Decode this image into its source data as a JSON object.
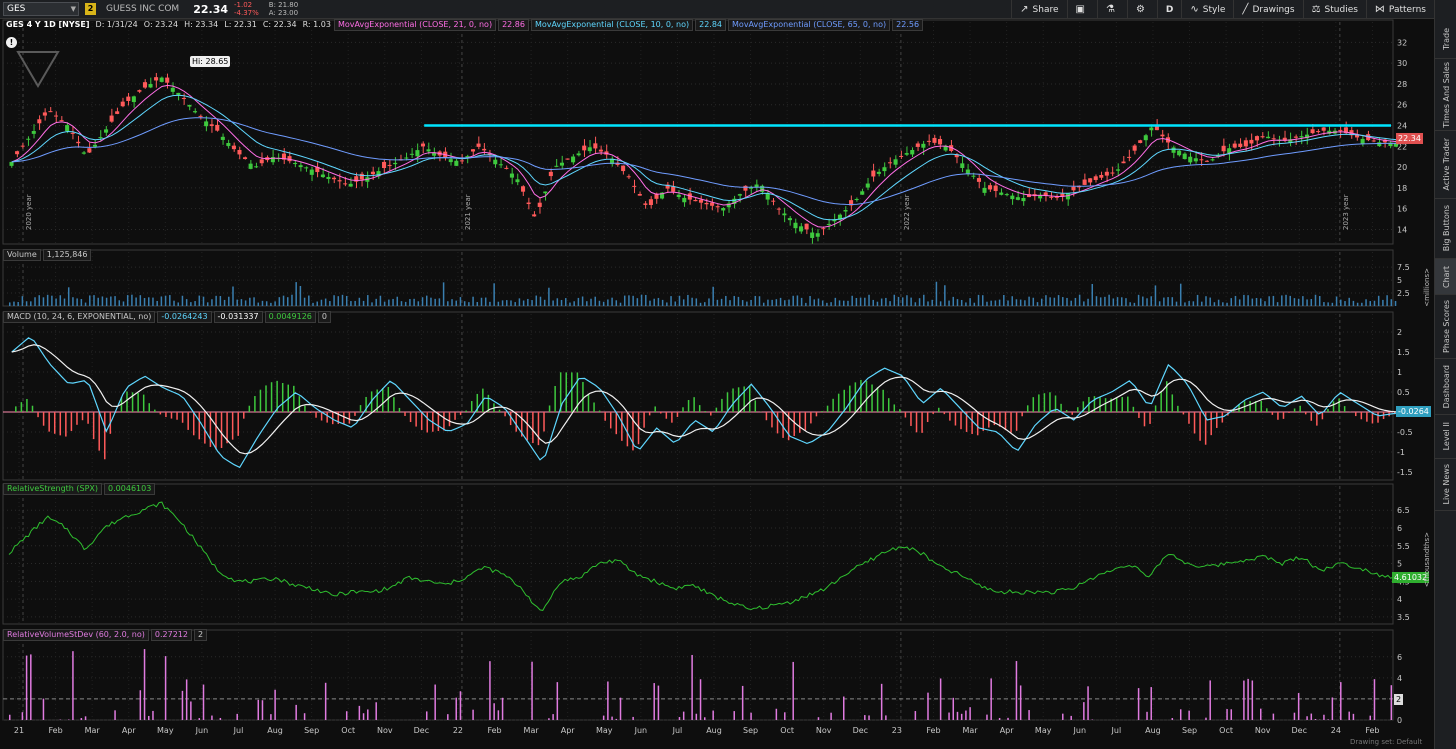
{
  "toolbar": {
    "symbol": "GES",
    "badge": "2",
    "company": "GUESS INC COM",
    "price": "22.34",
    "change": "-1.02",
    "change_pct": "-4.37%",
    "bid": "B: 21.80",
    "ask": "A: 23.00",
    "buttons": {
      "share": "Share",
      "style": "Style",
      "drawings": "Drawings",
      "studies": "Studies",
      "patterns": "Patterns",
      "period": "D"
    }
  },
  "sidebar": {
    "tabs": [
      "Trade",
      "Times And Sales",
      "Active Trader",
      "Big Buttons",
      "Chart",
      "Phase Scores",
      "Dashboard",
      "Level II",
      "Live News"
    ]
  },
  "price_header": {
    "title": "GES 4 Y 1D [NYSE]",
    "d": "D: 1/31/24",
    "o": "O: 23.24",
    "h": "H: 23.34",
    "l": "L: 22.31",
    "c": "C: 22.34",
    "r": "R: 1.03",
    "ema21": "MovAvgExponential (CLOSE, 21, 0, no)",
    "ema21_val": "22.86",
    "ema10": "MovAvgExponential (CLOSE, 10, 0, no)",
    "ema10_val": "22.84",
    "ema65": "MovAvgExponential (CLOSE, 65, 0, no)",
    "ema65_val": "22.56"
  },
  "volume_header": {
    "title": "Volume",
    "value": "1,125,846"
  },
  "macd_header": {
    "title": "MACD (10, 24, 6, EXPONENTIAL, no)",
    "v1": "-0.0264243",
    "v2": "-0.031337",
    "v3": "0.0049126",
    "v4": "0"
  },
  "rs_header": {
    "title": "RelativeStrength (SPX)",
    "value": "0.0046103"
  },
  "rv_header": {
    "title": "RelativeVolumeStDev (60, 2.0, no)",
    "value": "0.27212",
    "v2": "2"
  },
  "tags": {
    "price": "22.34",
    "macd": "-0.0264",
    "rs": "4.61032",
    "rv": "2",
    "hi": "Hi: 28.65"
  },
  "units": {
    "volume": "<millions>",
    "rs": "<thousandths>"
  },
  "year_labels": [
    "2020 year",
    "2021 year",
    "2022 year",
    "2023 year"
  ],
  "footer": {
    "drawing_set": "Drawing set: Default"
  },
  "colors": {
    "up": "#3ec93e",
    "down": "#ff5a5a",
    "ema_fast": "#ff6ee6",
    "ema_mid": "#5fd7ff",
    "ema_slow": "#6f9cff",
    "resistance": "#00e5ff",
    "rs": "#2fbf2f",
    "rv": "#e07be0"
  },
  "chart_data": [
    {
      "type": "line",
      "name": "price",
      "x_labels": [
        "21",
        "Feb",
        "Mar",
        "Apr",
        "May",
        "Jun",
        "Jul",
        "Aug",
        "Sep",
        "Oct",
        "Nov",
        "Dec",
        "22",
        "Feb",
        "Mar",
        "Apr",
        "May",
        "Jun",
        "Jul",
        "Aug",
        "Sep",
        "Oct",
        "Nov",
        "Dec",
        "23",
        "Feb",
        "Mar",
        "Apr",
        "May",
        "Jun",
        "Jul",
        "Aug",
        "Sep",
        "Oct",
        "Nov",
        "Dec",
        "24",
        "Feb"
      ],
      "y_ticks": [
        14,
        16,
        18,
        20,
        22,
        24,
        26,
        28,
        30,
        32
      ],
      "ylim": [
        12.6,
        33
      ],
      "close_series": [
        20.5,
        23,
        25.5,
        24,
        21,
        23.5,
        26,
        27.5,
        28.65,
        27,
        25,
        23.5,
        21.5,
        20,
        21,
        20.5,
        19.8,
        19,
        18.3,
        19,
        20,
        20.8,
        22,
        21,
        20.5,
        22,
        20.5,
        19,
        15,
        20,
        21,
        22,
        21,
        19,
        16,
        18,
        17,
        16.5,
        16,
        17.5,
        18.5,
        16,
        14.5,
        13.5,
        15,
        16.5,
        19,
        20.5,
        21.5,
        22.5,
        22,
        20,
        18,
        17.5,
        17,
        17.3,
        17,
        18,
        18.8,
        19.5,
        21.5,
        24,
        22,
        21,
        20.5,
        21.8,
        22,
        23,
        22.5,
        23,
        23.5,
        23.5,
        22.8,
        22.4,
        22.34
      ],
      "resistance": 24,
      "annotation": "Hi: 28.65"
    },
    {
      "type": "bar",
      "name": "volume",
      "y_ticks": [
        2.5,
        5,
        7.5
      ],
      "ylim": [
        0,
        8.5
      ]
    },
    {
      "type": "line",
      "name": "macd",
      "y_ticks": [
        -1.5,
        -1,
        -0.5,
        0.5,
        1,
        1.5,
        2
      ],
      "ylim": [
        -1.7,
        2.2
      ],
      "macd_series": [
        1.5,
        1.9,
        1.2,
        0.7,
        0.8,
        -0.5,
        0.6,
        0.9,
        0.6,
        0.4,
        -0.3,
        -1.1,
        -1.4,
        -0.6,
        0.1,
        0.5,
        0.1,
        -0.2,
        -0.4,
        0.3,
        0.8,
        0.3,
        -0.2,
        -0.5,
        -0.3,
        0.4,
        0.1,
        -0.6,
        -1.3,
        0.2,
        0.9,
        0.6,
        -0.1,
        -1,
        -0.4,
        -0.8,
        -0.2,
        -0.5,
        0.2,
        0.7,
        0.1,
        -0.6,
        -0.8,
        -0.5,
        0.1,
        0.8,
        1.1,
        0.9,
        0.2,
        0.6,
        0.1,
        -0.4,
        -0.5,
        -1,
        -0.3,
        0.1,
        -0.2,
        0.3,
        0.5,
        0.8,
        0.1,
        1.2,
        0.7,
        -0.2,
        -0.1,
        0.3,
        0.5,
        0.1,
        0.4,
        -0.1,
        0.5,
        0.2,
        -0.1,
        -0.03
      ]
    },
    {
      "type": "line",
      "name": "relative_strength",
      "y_ticks": [
        3.5,
        4,
        4.5,
        5,
        5.5,
        6,
        6.5
      ],
      "ylim": [
        3.3,
        6.9
      ],
      "rs_series": [
        5.3,
        5.8,
        6.3,
        6.0,
        5.4,
        6.0,
        6.3,
        6.5,
        6.7,
        6.2,
        5.5,
        4.8,
        4.5,
        4.5,
        4.6,
        4.4,
        4.3,
        4.1,
        4.2,
        4.2,
        4.3,
        4.6,
        4.5,
        4.4,
        4.6,
        4.9,
        4.7,
        4.3,
        3.6,
        4.5,
        4.6,
        5.0,
        5.1,
        4.7,
        4.5,
        4.3,
        4.4,
        4.1,
        3.9,
        3.7,
        3.8,
        3.9,
        4.1,
        4.3,
        4.7,
        5.0,
        5.3,
        5.5,
        5.3,
        4.9,
        4.7,
        4.4,
        4.2,
        4.2,
        4.2,
        4.2,
        4.3,
        4.6,
        4.8,
        5.0,
        4.6,
        5.3,
        5.0,
        4.9,
        5.0,
        5.1,
        5.2,
        5.0,
        5.2,
        4.8,
        5.0,
        4.9,
        4.7,
        4.61
      ]
    },
    {
      "type": "bar",
      "name": "relative_volume",
      "y_ticks": [
        0,
        2,
        4,
        6
      ],
      "ylim": [
        0,
        7.4
      ]
    }
  ]
}
